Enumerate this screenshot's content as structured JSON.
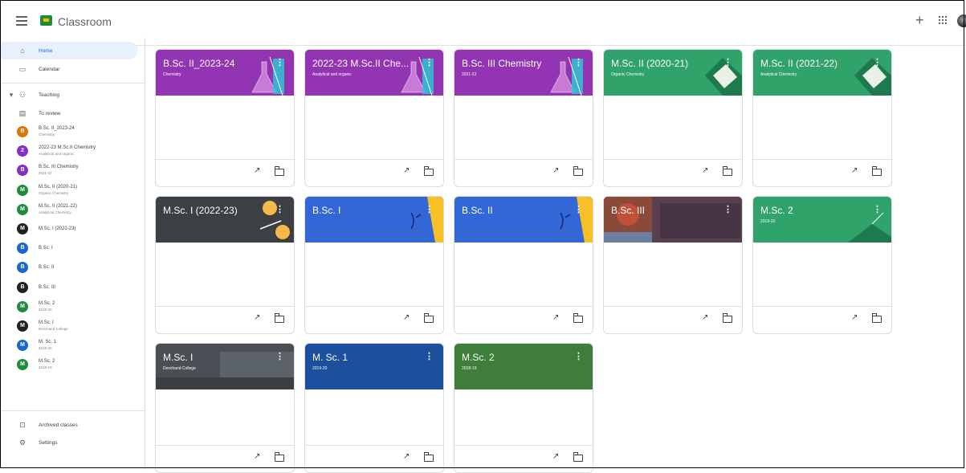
{
  "app": {
    "title": "Classroom",
    "menu_icon": "hamburger-menu-icon",
    "create_icon": "plus-icon",
    "apps_icon": "apps-grid-icon"
  },
  "sidebar": {
    "top_items": [
      {
        "label": "Home",
        "icon": "home-icon"
      },
      {
        "label": "Calendar",
        "icon": "calendar-icon"
      }
    ],
    "teaching": {
      "label": "Teaching",
      "icon": "people-icon"
    },
    "to_review": {
      "label": "To review",
      "icon": "review-folder-icon"
    },
    "classes": [
      {
        "initial": "B",
        "name": "B.Sc. II_2023-24",
        "sub": "Chemistry",
        "color": "#e37400"
      },
      {
        "initial": "2",
        "name": "2022-23 M.Sc.II Chemistry",
        "sub": "Analytical and organic",
        "color": "#8430ce"
      },
      {
        "initial": "B",
        "name": "B.Sc. III Chemistry",
        "sub": "2021-22",
        "color": "#8430ce"
      },
      {
        "initial": "M",
        "name": "M.Sc. II (2020-21)",
        "sub": "Organic Chemistry",
        "color": "#1e8e3e"
      },
      {
        "initial": "M",
        "name": "M.Sc. II (2021-22)",
        "sub": "Analytical Chemistry",
        "color": "#1e8e3e"
      },
      {
        "initial": "M",
        "name": "M.Sc. I (2022-23)",
        "sub": "",
        "color": "#202124"
      },
      {
        "initial": "B",
        "name": "B.Sc. I",
        "sub": "",
        "color": "#1967d2"
      },
      {
        "initial": "B",
        "name": "B.Sc. II",
        "sub": "",
        "color": "#1967d2"
      },
      {
        "initial": "B",
        "name": "B.Sc. III",
        "sub": "",
        "color": "#202124"
      },
      {
        "initial": "M",
        "name": "M.Sc. 2",
        "sub": "2019-20",
        "color": "#1e8e3e"
      },
      {
        "initial": "M",
        "name": "M.Sc. I",
        "sub": "Devchand College",
        "color": "#202124"
      },
      {
        "initial": "M",
        "name": "M. Sc. 1",
        "sub": "2019-20",
        "color": "#1967d2"
      },
      {
        "initial": "M",
        "name": "M.Sc. 2",
        "sub": "2018-19",
        "color": "#1e8e3e"
      }
    ],
    "archived": {
      "label": "Archived classes",
      "icon": "archive-icon"
    },
    "settings": {
      "label": "Settings",
      "icon": "settings-gear-icon"
    }
  },
  "cards": [
    {
      "title": "B.Sc. II_2023-24",
      "sub": "Chemistry",
      "bg": "#9334b3",
      "art": "flask"
    },
    {
      "title": "2022-23 M.Sc.II Che...",
      "sub": "Analytical and organic",
      "bg": "#9334b3",
      "art": "flask"
    },
    {
      "title": "B.Sc. III Chemistry",
      "sub": "2021-22",
      "bg": "#9334b3",
      "art": "flask"
    },
    {
      "title": "M.Sc. II (2020-21)",
      "sub": "Organic Chemistry",
      "bg": "#2fa36a",
      "art": "book"
    },
    {
      "title": "M.Sc. II (2021-22)",
      "sub": "Analytical Chemistry",
      "bg": "#2fa36a",
      "art": "book"
    },
    {
      "title": "M.Sc. I (2022-23)",
      "sub": "",
      "bg": "#3c4043",
      "art": "lamp"
    },
    {
      "title": "B.Sc. I",
      "sub": "",
      "bg": "#3367d6",
      "art": "science"
    },
    {
      "title": "B.Sc. II",
      "sub": "",
      "bg": "#3367d6",
      "art": "science"
    },
    {
      "title": "B.Sc. III",
      "sub": "",
      "bg": "#6d4c5a",
      "art": "photo"
    },
    {
      "title": "M.Sc. 2",
      "sub": "2019-20",
      "bg": "#2fa36a",
      "art": "hill"
    },
    {
      "title": "M.Sc. I",
      "sub": "Devchand College",
      "bg": "#4a4f55",
      "art": "photo2"
    },
    {
      "title": "M. Sc. 1",
      "sub": "2019-20",
      "bg": "#1c4f9c",
      "art": "none"
    },
    {
      "title": "M.Sc. 2",
      "sub": "2018-19",
      "bg": "#3f7d3a",
      "art": "none"
    }
  ]
}
